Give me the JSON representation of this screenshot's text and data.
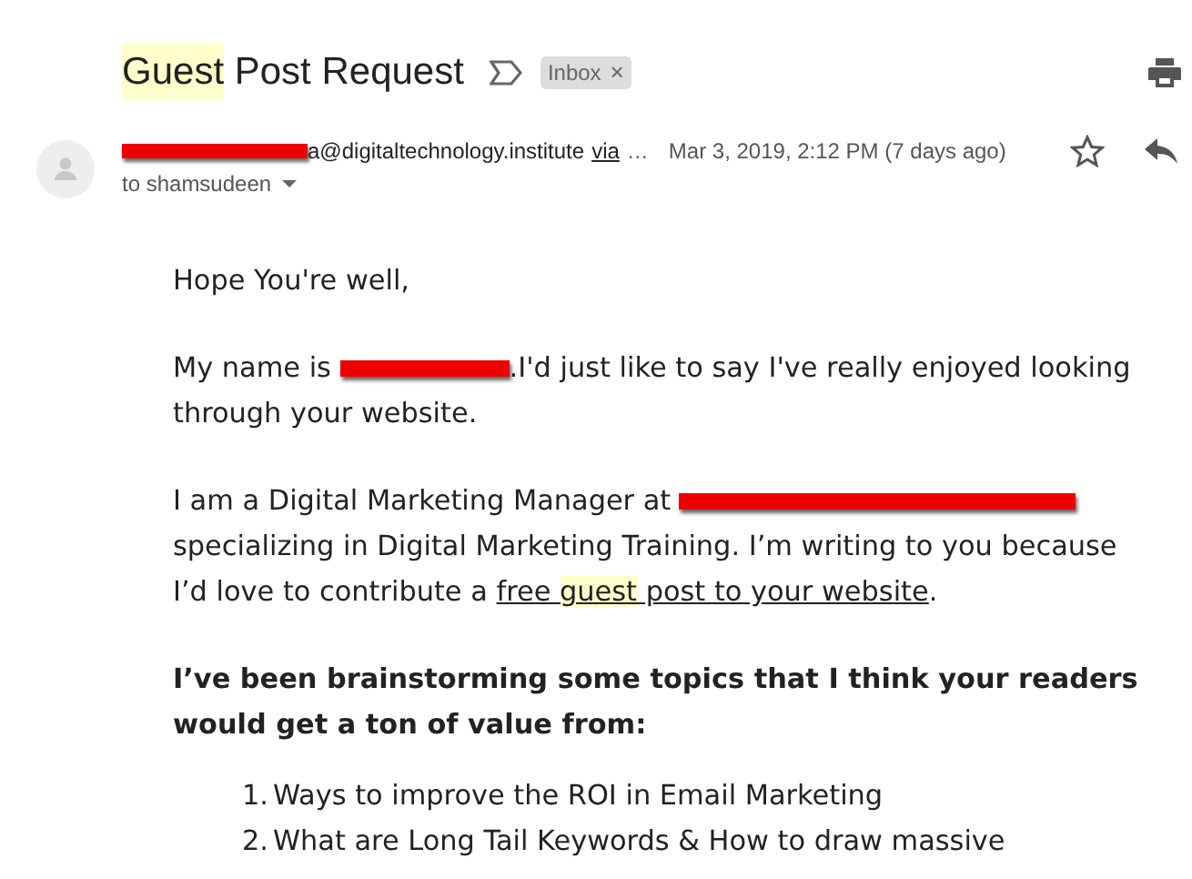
{
  "subject": {
    "parts": [
      {
        "text": "Guest",
        "highlighted": true
      },
      {
        "text": " Post Request",
        "highlighted": false
      }
    ]
  },
  "label": {
    "text": "Inbox",
    "close": "×"
  },
  "sender": {
    "redacted": true,
    "address": "a@digitaltechnology.institute",
    "via": "via",
    "more": "…",
    "date": "Mar 3, 2019, 2:12 PM (7 days ago)",
    "starred": false,
    "recipient": "to shamsudeen"
  },
  "body": [
    {
      "kind": "paragraph",
      "lines": [
        [
          {
            "kind": "text",
            "text": "Hope You're well,"
          }
        ]
      ]
    },
    {
      "kind": "paragraph",
      "lines": [
        [
          {
            "kind": "text",
            "text": "My name is "
          },
          {
            "kind": "redaction"
          },
          {
            "kind": "text",
            "text": ".I'd just like to say I've really enjoyed looking"
          }
        ],
        [
          {
            "kind": "text",
            "text": "through your website."
          }
        ]
      ]
    },
    {
      "kind": "paragraph",
      "lines": [
        [
          {
            "kind": "text",
            "text": "I am a Digital Marketing Manager at "
          },
          {
            "kind": "redaction"
          }
        ],
        [
          {
            "kind": "text",
            "text": "specializing in Digital Marketing Training. I’m writing to you because"
          }
        ],
        [
          {
            "kind": "text",
            "text": "I’d love to contribute a "
          },
          {
            "kind": "link",
            "parts": [
              {
                "text": "free ",
                "highlighted": false
              },
              {
                "text": "guest",
                "highlighted": true
              },
              {
                "text": " post to your website",
                "highlighted": false
              }
            ]
          },
          {
            "kind": "text",
            "text": "."
          }
        ]
      ]
    },
    {
      "kind": "bold",
      "lines": [
        [
          {
            "kind": "text",
            "text": "I’ve been brainstorming some topics that I think your readers"
          }
        ],
        [
          {
            "kind": "text",
            "text": "would get a ton of value from:"
          }
        ]
      ]
    },
    {
      "kind": "list",
      "items": [
        {
          "number": "1.",
          "text": "Ways to improve the ROI in Email Marketing"
        },
        {
          "number": "2.",
          "text": "What are Long Tail Keywords & How to draw massive"
        }
      ]
    }
  ]
}
